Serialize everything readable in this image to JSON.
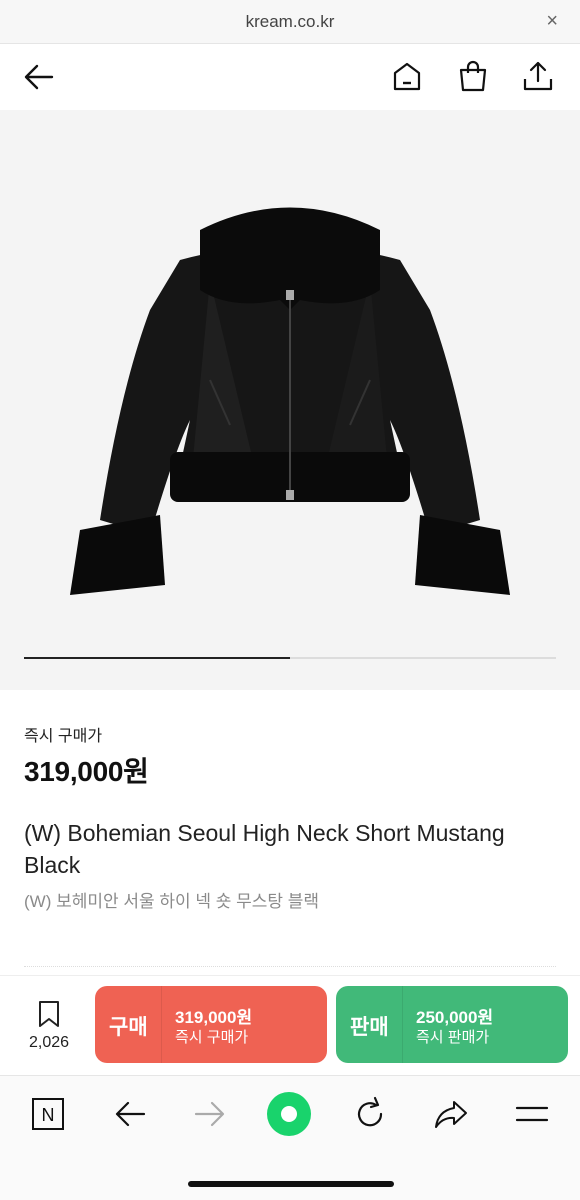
{
  "browser": {
    "url": "kream.co.kr",
    "close_glyph": "×"
  },
  "header": {
    "icons": [
      "back-arrow-icon",
      "home-icon",
      "shopping-bag-icon",
      "share-icon"
    ]
  },
  "product": {
    "image_alt": "black shearling cropped jacket",
    "slider_progress": 0.5,
    "price_label": "즉시 구매가",
    "price": "319,000원",
    "title_en": "(W) Bohemian Seoul High Neck Short Mustang Black",
    "title_ko": "(W) 보헤미안 서울 하이 넥 숏 무스탕 블랙"
  },
  "actions": {
    "wish_count": "2,026",
    "buy": {
      "label": "구매",
      "price": "319,000원",
      "sub_label": "즉시 구매가",
      "color": "#ef6253"
    },
    "sell": {
      "label": "판매",
      "price": "250,000원",
      "sub_label": "즉시 판매가",
      "color": "#41b979"
    }
  },
  "browser_nav": {
    "icons": [
      "naver-n-icon",
      "back-icon",
      "forward-icon",
      "green-dot-icon",
      "reload-icon",
      "share-icon",
      "menu-icon"
    ],
    "n_glyph": "N"
  }
}
